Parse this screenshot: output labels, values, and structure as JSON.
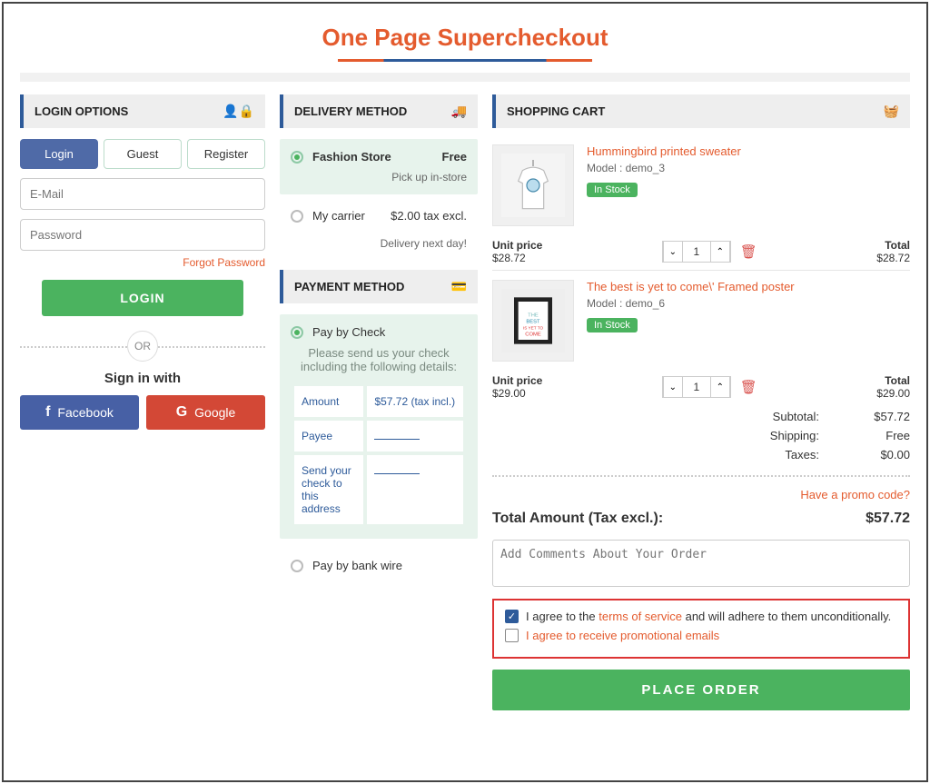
{
  "page": {
    "title": "One Page Supercheckout"
  },
  "login": {
    "header": "LOGIN OPTIONS",
    "tabs": {
      "login": "Login",
      "guest": "Guest",
      "register": "Register"
    },
    "email_ph": "E-Mail",
    "password_ph": "Password",
    "forgot": "Forgot Password",
    "login_btn": "LOGIN",
    "or": "OR",
    "signin_with": "Sign in with",
    "facebook": "Facebook",
    "google": "Google"
  },
  "delivery": {
    "header": "DELIVERY METHOD",
    "options": [
      {
        "label": "Fashion Store",
        "price": "Free",
        "sub": "Pick up in-store",
        "selected": true
      },
      {
        "label": "My carrier",
        "price": "$2.00 tax excl.",
        "sub": "Delivery next day!",
        "selected": false
      }
    ]
  },
  "payment": {
    "header": "PAYMENT METHOD",
    "check": {
      "label": "Pay by Check",
      "selected": true,
      "desc": "Please send us your check including the following details:",
      "rows": {
        "amount_label": "Amount",
        "amount_value": "$57.72 (tax incl.)",
        "payee_label": "Payee",
        "address_label": "Send your check to this address"
      }
    },
    "wire": {
      "label": "Pay by bank wire",
      "selected": false
    }
  },
  "cart": {
    "header": "SHOPPING CART",
    "items": [
      {
        "name": "Hummingbird printed sweater",
        "model": "Model : demo_3",
        "stock": "In Stock",
        "unit_label": "Unit price",
        "unit_price": "$28.72",
        "qty": "1",
        "total_label": "Total",
        "total": "$28.72"
      },
      {
        "name": "The best is yet to come\\' Framed poster",
        "model": "Model : demo_6",
        "stock": "In Stock",
        "unit_label": "Unit price",
        "unit_price": "$29.00",
        "qty": "1",
        "total_label": "Total",
        "total": "$29.00"
      }
    ],
    "totals": {
      "subtotal_label": "Subtotal:",
      "subtotal": "$57.72",
      "shipping_label": "Shipping:",
      "shipping": "Free",
      "taxes_label": "Taxes:",
      "taxes": "$0.00"
    },
    "promo": "Have a promo code?",
    "grand_label": "Total Amount (Tax excl.):",
    "grand_value": "$57.72",
    "comments_ph": "Add Comments About Your Order",
    "agree1_a": "I agree to the ",
    "agree1_link": "terms of service",
    "agree1_b": " and will adhere to them unconditionally.",
    "agree2": "I agree to receive promotional emails",
    "place": "PLACE ORDER"
  },
  "chart_data": {
    "type": "table",
    "title": "Order totals",
    "rows": [
      {
        "label": "Subtotal",
        "value": 57.72,
        "unit": "USD"
      },
      {
        "label": "Shipping",
        "value": 0.0,
        "unit": "USD"
      },
      {
        "label": "Taxes",
        "value": 0.0,
        "unit": "USD"
      },
      {
        "label": "Total (tax excl.)",
        "value": 57.72,
        "unit": "USD"
      }
    ]
  }
}
